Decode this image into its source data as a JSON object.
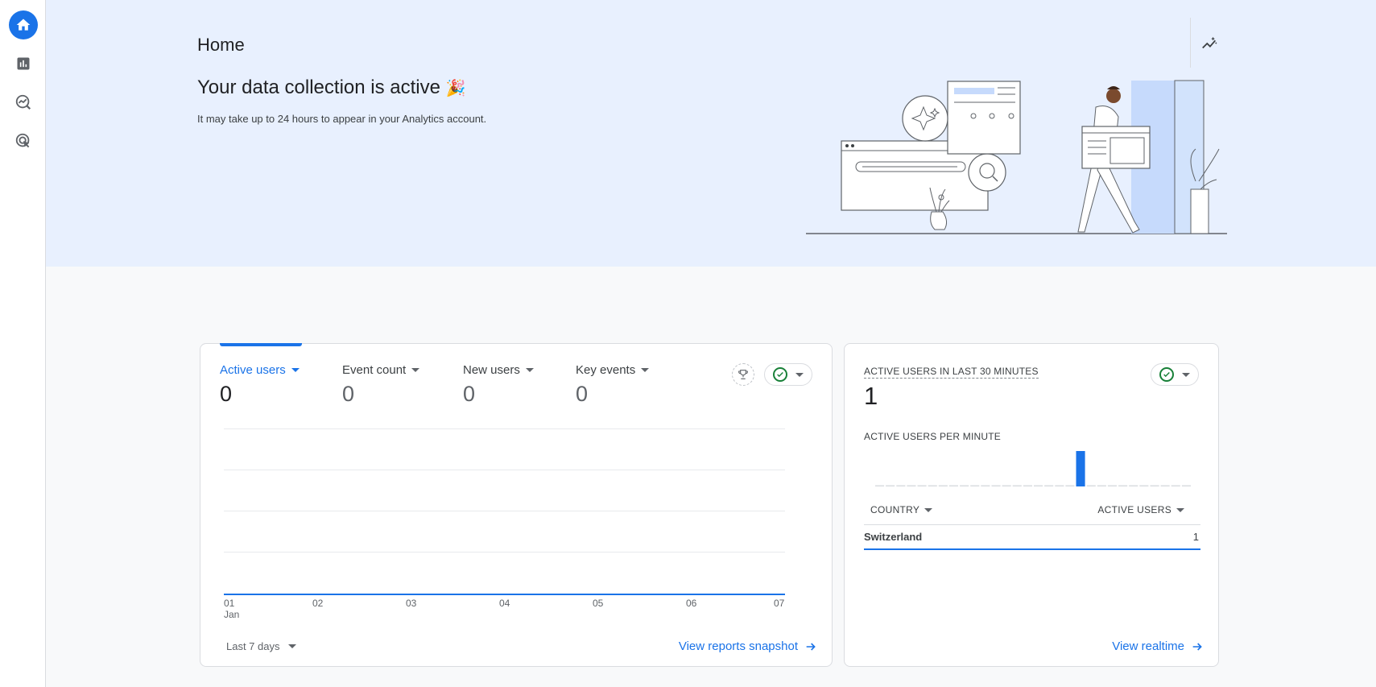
{
  "page": {
    "title": "Home",
    "hero_title": "Your data collection is active",
    "hero_emoji": "🎉",
    "hero_subtitle": "It may take up to 24 hours to appear in your Analytics account."
  },
  "nav": {
    "items": [
      {
        "icon": "home-icon",
        "active": true
      },
      {
        "icon": "reports-icon",
        "active": false
      },
      {
        "icon": "explore-icon",
        "active": false
      },
      {
        "icon": "advertising-icon",
        "active": false
      }
    ]
  },
  "overview": {
    "metrics": [
      {
        "label": "Active users",
        "value": "0",
        "selected": true
      },
      {
        "label": "Event count",
        "value": "0",
        "selected": false
      },
      {
        "label": "New users",
        "value": "0",
        "selected": false
      },
      {
        "label": "Key events",
        "value": "0",
        "selected": false
      }
    ],
    "x_ticks": [
      "01",
      "02",
      "03",
      "04",
      "05",
      "06",
      "07"
    ],
    "x_tick_sub": "Jan",
    "date_range": "Last 7 days",
    "link": "View reports snapshot"
  },
  "chart_data": {
    "type": "line",
    "x": [
      "01",
      "02",
      "03",
      "04",
      "05",
      "06",
      "07"
    ],
    "series": [
      {
        "values": [
          0,
          0,
          0,
          0,
          0,
          0,
          0
        ]
      }
    ],
    "grid": true
  },
  "realtime": {
    "title": "ACTIVE USERS IN LAST 30 MINUTES",
    "value": "1",
    "per_minute_label": "ACTIVE USERS PER MINUTE",
    "per_minute": [
      0,
      0,
      0,
      0,
      0,
      0,
      0,
      0,
      0,
      0,
      0,
      0,
      0,
      0,
      0,
      0,
      0,
      0,
      0,
      1,
      0,
      0,
      0,
      0,
      0,
      0,
      0,
      0,
      0,
      0
    ],
    "col_country": "COUNTRY",
    "col_users": "ACTIVE USERS",
    "rows": [
      {
        "country": "Switzerland",
        "users": "1"
      }
    ],
    "link": "View realtime"
  },
  "colors": {
    "accent": "#1a73e8",
    "hero_bg": "#e8f0fe",
    "ok": "#188038"
  }
}
